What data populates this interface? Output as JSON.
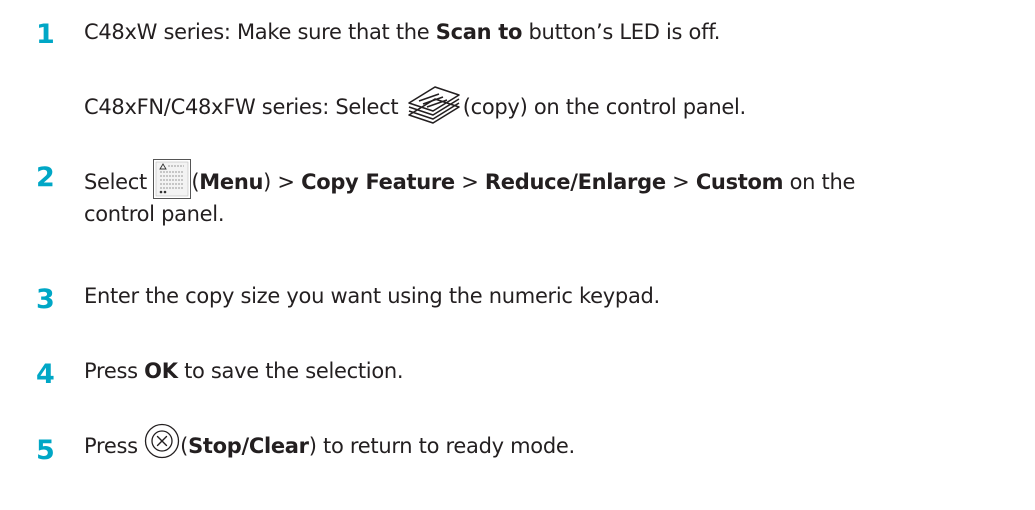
{
  "steps": [
    {
      "number": "1",
      "line1": {
        "prefix": "C48xW series: Make sure that the ",
        "bold": "Scan to",
        "suffix": " button’s LED is off."
      },
      "line2": {
        "prefix": "C48xFN/C48xFW series: Select ",
        "icon": "copy-icon",
        "suffix": "(copy) on the control panel."
      }
    },
    {
      "number": "2",
      "line1": {
        "prefix": "Select ",
        "icon": "menu-icon",
        "paren_open": "(",
        "menu": "Menu",
        "paren_close": ")",
        "sep1": " > ",
        "copy_feature": "Copy Feature",
        "sep2": " > ",
        "reduce_enlarge": "Reduce/Enlarge",
        "sep3": " > ",
        "custom": "Custom",
        "suffix": " on the"
      },
      "line2": "control panel."
    },
    {
      "number": "3",
      "text": "Enter the copy size you want using the numeric keypad."
    },
    {
      "number": "4",
      "prefix": "Press ",
      "bold": "OK",
      "suffix": " to save the selection."
    },
    {
      "number": "5",
      "prefix": "Press ",
      "icon": "stop-clear-icon",
      "paren_open": "(",
      "bold": "Stop/Clear",
      "paren_close": ")",
      "suffix": " to return to ready mode."
    }
  ],
  "colors": {
    "step_number": "#00a7c6",
    "text": "#231f20"
  }
}
